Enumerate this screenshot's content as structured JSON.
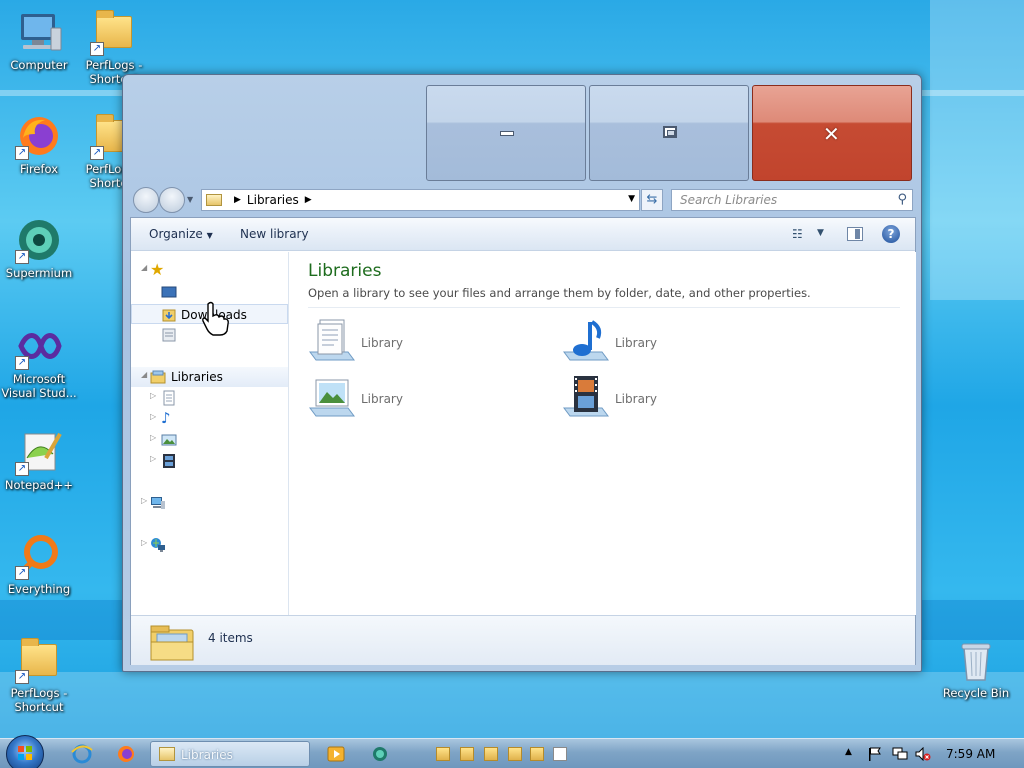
{
  "desktop": {
    "icons": [
      {
        "name": "desktop-icon-computer",
        "label": "Computer"
      },
      {
        "name": "desktop-icon-perflogs-1",
        "label": "PerfLogs - Shortcut"
      },
      {
        "name": "desktop-icon-firefox",
        "label": "Firefox"
      },
      {
        "name": "desktop-icon-perflogs-2",
        "label": "PerfLogs - Shortcut"
      },
      {
        "name": "desktop-icon-supermium",
        "label": "Supermium"
      },
      {
        "name": "desktop-icon-visual-studio",
        "label": "Microsoft Visual Stud..."
      },
      {
        "name": "desktop-icon-notepadpp",
        "label": "Notepad++"
      },
      {
        "name": "desktop-icon-everything",
        "label": "Everything"
      },
      {
        "name": "desktop-icon-perflogs-3",
        "label": "PerfLogs - Shortcut"
      },
      {
        "name": "desktop-icon-recycle-bin",
        "label": "Recycle Bin"
      }
    ]
  },
  "window": {
    "address": {
      "crumb": "Libraries"
    },
    "search": {
      "placeholder": "Search Libraries"
    },
    "toolbar": {
      "organize": "Organize",
      "new_library": "New library"
    },
    "nav": {
      "downloads": "Downloads",
      "libraries": "Libraries"
    },
    "content": {
      "title": "Libraries",
      "subtitle": "Open a library to see your files and arrange them by folder, date, and other properties.",
      "items": [
        {
          "label": "Library",
          "icon": "documents-library-icon"
        },
        {
          "label": "Library",
          "icon": "music-library-icon"
        },
        {
          "label": "Library",
          "icon": "pictures-library-icon"
        },
        {
          "label": "Library",
          "icon": "videos-library-icon"
        }
      ]
    },
    "details": {
      "count": "4 items"
    }
  },
  "taskbar": {
    "explorer_task": "Libraries",
    "clock": "7:59 AM"
  },
  "colors": {
    "title_green": "#1e6c1e",
    "close_red": "#c64b33",
    "taskbar_blue": "#7fa4c6"
  }
}
